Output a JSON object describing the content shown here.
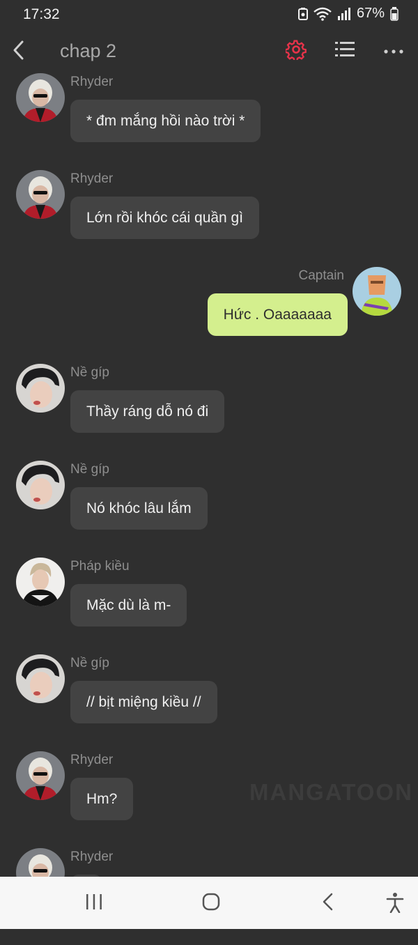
{
  "status": {
    "time": "17:32",
    "battery": "67%"
  },
  "header": {
    "title": "chap 2",
    "accent": "#e8334a"
  },
  "messages": [
    {
      "sender": "Rhyder",
      "text": "* đm mắng hồi nào trời *",
      "side": "left",
      "avatar": "rhyder"
    },
    {
      "sender": "Rhyder",
      "text": "Lớn rồi khóc cái quần gì",
      "side": "left",
      "avatar": "rhyder"
    },
    {
      "sender": "Captain",
      "text": "Hức . Oaaaaaaa",
      "side": "right",
      "avatar": "captain"
    },
    {
      "sender": "Nề gíp",
      "text": "Thầy ráng dỗ nó đi",
      "side": "left",
      "avatar": "negip"
    },
    {
      "sender": "Nề gíp",
      "text": "Nó khóc lâu lắm",
      "side": "left",
      "avatar": "negip"
    },
    {
      "sender": "Pháp kiều",
      "text": "Mặc dù là m-",
      "side": "left",
      "avatar": "phapkieu"
    },
    {
      "sender": "Nề gíp",
      "text": "// bịt miệng kiều //",
      "side": "left",
      "avatar": "negip"
    },
    {
      "sender": "Rhyder",
      "text": "Hm?",
      "side": "left",
      "avatar": "rhyder"
    },
    {
      "sender": "Rhyder",
      "text": "",
      "side": "left",
      "avatar": "rhyder"
    }
  ],
  "watermark": "MANGATOON",
  "colors": {
    "background": "#2f2f2f",
    "bubble_left": "#434343",
    "bubble_right": "#d4ef8e",
    "sender_text": "#8e8e8e"
  },
  "nav": {
    "icons": [
      "recent-apps-icon",
      "home-icon",
      "back-icon",
      "accessibility-icon"
    ]
  }
}
